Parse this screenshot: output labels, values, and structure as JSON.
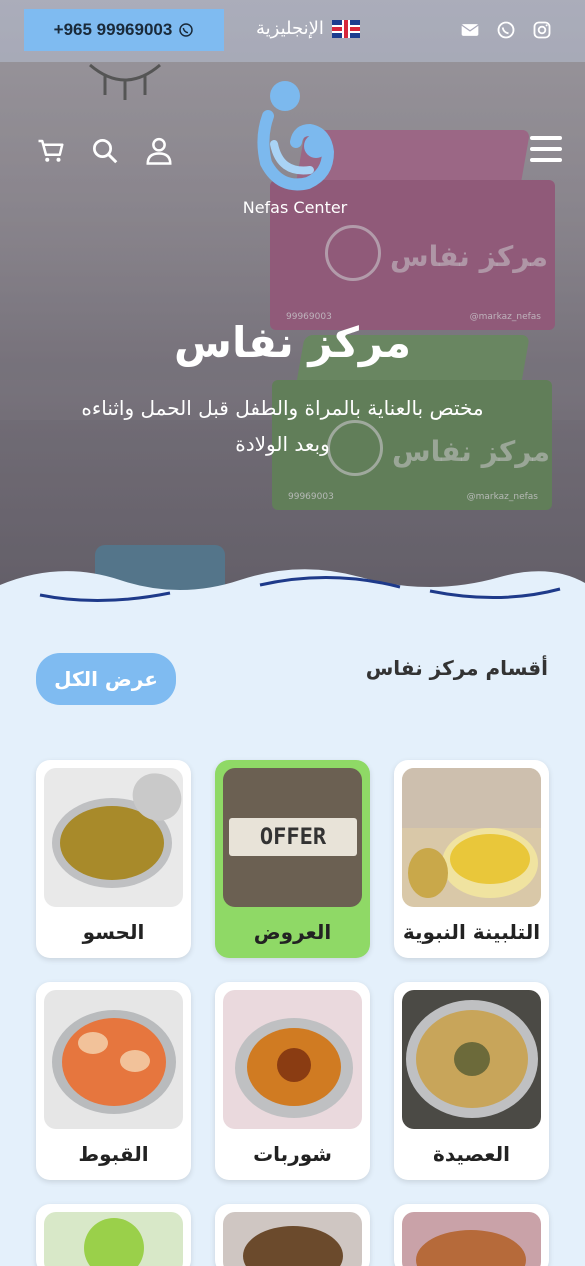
{
  "topbar": {
    "phone": "+965 99969003",
    "language": "الإنجليزية",
    "icons": [
      "instagram-icon",
      "whatsapp-icon",
      "mail-icon"
    ]
  },
  "logo": {
    "text": "Nefas Center"
  },
  "hero": {
    "title": "مركز نفاس",
    "subtitle": "مختص بالعناية بالمراة والطفل قبل الحمل واثناءه وبعد الولادة",
    "box_print": "مركز نفاس",
    "box_phone": "99969003",
    "box_handle": "@markaz_nefas"
  },
  "section": {
    "title": "أقسام مركز نفاس",
    "view_all": "عرض الكل"
  },
  "categories": [
    {
      "label": "الحسو",
      "active": false
    },
    {
      "label": "العروض",
      "active": true,
      "badge": "OFFER"
    },
    {
      "label": "التلبينة النبوية",
      "active": false
    },
    {
      "label": "القبوط",
      "active": false
    },
    {
      "label": "شوربات",
      "active": false
    },
    {
      "label": "العصيدة",
      "active": false
    }
  ],
  "colors": {
    "accent": "#7fbbf1",
    "active_card": "#8fd966",
    "page_bg": "#e4f0fb"
  }
}
